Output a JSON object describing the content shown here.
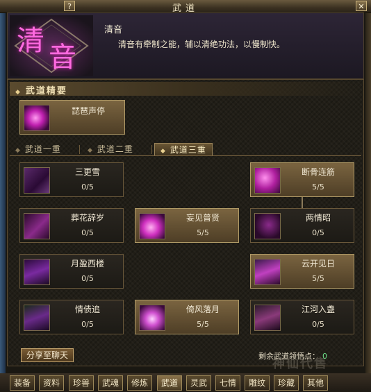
{
  "window": {
    "title": "武道",
    "help_label": "?",
    "close_label": "✕"
  },
  "header": {
    "emblem_text": [
      "清",
      "音"
    ],
    "skill_name": "清音",
    "skill_desc": "清音有牵制之能，辅以清绝功法，以慢制快。"
  },
  "essence": {
    "title": "武道精要",
    "card": {
      "name": "琵琶声停",
      "icon": "pipa-skill-icon"
    }
  },
  "tabs": [
    {
      "label": "武道一重",
      "selected": false
    },
    {
      "label": "武道二重",
      "selected": false
    },
    {
      "label": "武道三重",
      "selected": true
    }
  ],
  "skills": [
    {
      "name": "三更雪",
      "level": "0/5",
      "active": false,
      "icon": "snow-skill-icon"
    },
    {
      "name": "断骨连筋",
      "level": "5/5",
      "active": true,
      "icon": "bone-skill-icon"
    },
    {
      "name": "葬花辞岁",
      "level": "0/5",
      "active": false,
      "icon": "flower-skill-icon"
    },
    {
      "name": "妄见普贤",
      "level": "5/5",
      "active": true,
      "icon": "vision-skill-icon"
    },
    {
      "name": "两情昭",
      "level": "0/5",
      "active": false,
      "icon": "dual-skill-icon"
    },
    {
      "name": "月盈西楼",
      "level": "0/5",
      "active": false,
      "icon": "moon-skill-icon"
    },
    {
      "name": "云开见日",
      "level": "5/5",
      "active": true,
      "icon": "sun-skill-icon"
    },
    {
      "name": "情债追",
      "level": "0/5",
      "active": false,
      "icon": "debt-skill-icon"
    },
    {
      "name": "倚风落月",
      "level": "5/5",
      "active": true,
      "icon": "wind-skill-icon"
    },
    {
      "name": "江河入盏",
      "level": "0/5",
      "active": false,
      "icon": "river-skill-icon"
    }
  ],
  "footer": {
    "share_label": "分享至聊天",
    "points_label": "剩余武道领悟点：",
    "points_value": "0"
  },
  "watermark": "神仙代售",
  "bottom_nav": [
    {
      "label": "装备",
      "selected": false
    },
    {
      "label": "资料",
      "selected": false
    },
    {
      "label": "珍兽",
      "selected": false
    },
    {
      "label": "武魂",
      "selected": false
    },
    {
      "label": "修炼",
      "selected": false
    },
    {
      "label": "武道",
      "selected": true
    },
    {
      "label": "灵武",
      "selected": false
    },
    {
      "label": "七情",
      "selected": false
    },
    {
      "label": "雕纹",
      "selected": false
    },
    {
      "label": "珍藏",
      "selected": false
    },
    {
      "label": "其他",
      "selected": false
    }
  ],
  "colors": {
    "accent": "#c8a870",
    "magenta": "#d040c0",
    "points_green": "#6ee08a"
  }
}
